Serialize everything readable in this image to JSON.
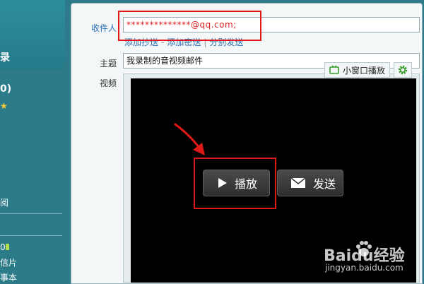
{
  "sidebar": {
    "title_fragment": "录",
    "count_fragment": "0)",
    "item_1": "阅",
    "item_2": "0",
    "item_3": "信片",
    "item_4": "事本"
  },
  "compose": {
    "recipient_label": "收件人",
    "recipient_value": "**************@qq.com;",
    "add_cc": "添加抄送",
    "add_bcc": "添加密送",
    "separate_send": "分别发送",
    "link_dash": "-",
    "link_pipe": "|",
    "subject_label": "主题",
    "subject_value": "我录制的音视频邮件",
    "video_label": "视频",
    "small_window_play": "小窗口播放"
  },
  "video": {
    "play_label": "播放",
    "send_label": "发送"
  },
  "watermark": {
    "brand": "Baidu经验",
    "url": "jingyan.baidu.com"
  },
  "colors": {
    "highlight": "#e01818",
    "link": "#2a6fb5",
    "sidebar": "#2f7a8a"
  }
}
